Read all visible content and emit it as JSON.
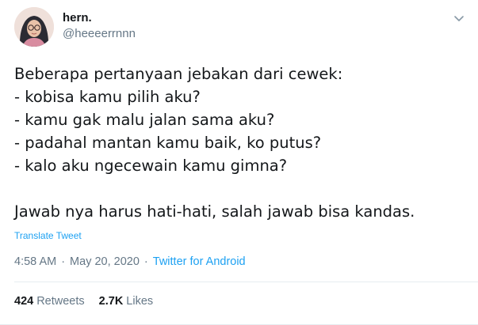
{
  "user": {
    "name": "hern.",
    "handle": "@heeeerrnnn"
  },
  "tweet": {
    "lines": [
      "Beberapa pertanyaan jebakan dari cewek:",
      "- kobisa kamu pilih aku?",
      "- kamu gak malu jalan sama aku?",
      "- padahal mantan kamu baik, ko putus?",
      "- kalo aku ngecewain kamu gimna?",
      "",
      "Jawab nya harus hati-hati, salah jawab bisa kandas."
    ],
    "translate_label": "Translate Tweet",
    "time": "4:58 AM",
    "separator": "·",
    "date": "May 20, 2020",
    "source": "Twitter for Android"
  },
  "stats": {
    "retweets_count": "424",
    "retweets_label": "Retweets",
    "likes_count": "2.7K",
    "likes_label": "Likes"
  },
  "icons": {
    "avatar": "avatar-photo",
    "more": "chevron-down-icon"
  },
  "colors": {
    "text": "#14171a",
    "secondary": "#657786",
    "link": "#1da1f2",
    "border": "#e6ecf0"
  }
}
